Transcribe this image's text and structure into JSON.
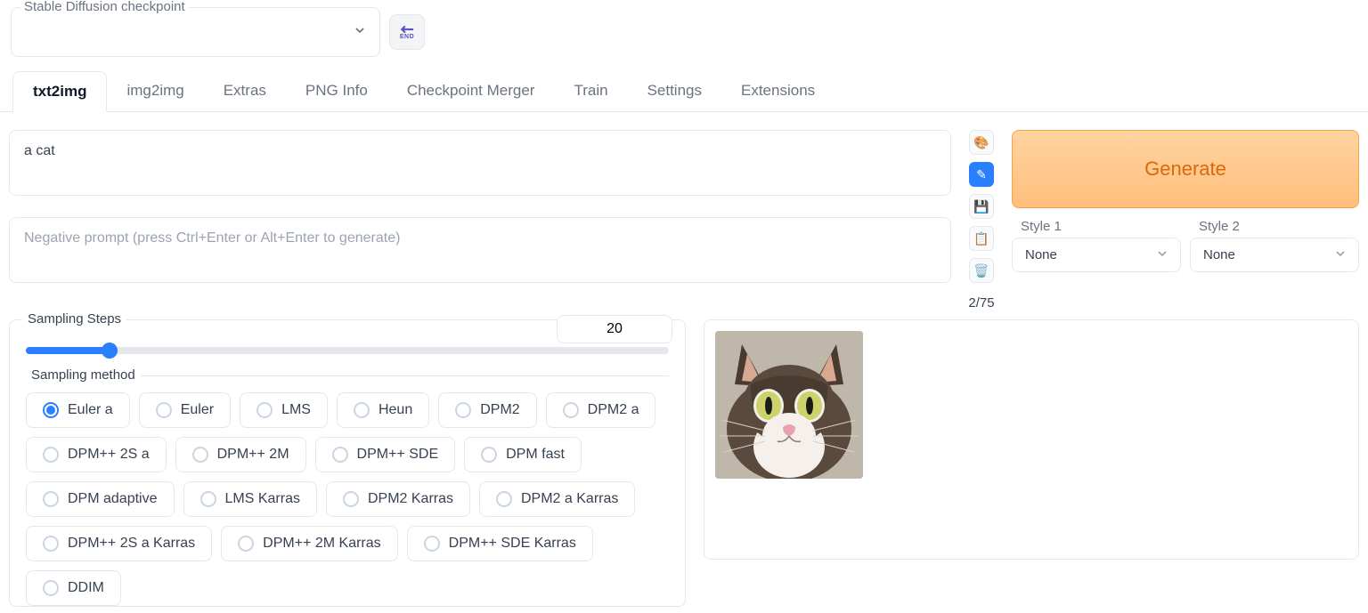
{
  "checkpoint": {
    "label": "Stable Diffusion checkpoint",
    "value": ""
  },
  "tabs": [
    "txt2img",
    "img2img",
    "Extras",
    "PNG Info",
    "Checkpoint Merger",
    "Train",
    "Settings",
    "Extensions"
  ],
  "active_tab": 0,
  "prompt": {
    "value": "a cat",
    "negative_placeholder": "Negative prompt (press Ctrl+Enter or Alt+Enter to generate)"
  },
  "token_count": "2/75",
  "generate_label": "Generate",
  "styles": {
    "style1": {
      "label": "Style 1",
      "value": "None"
    },
    "style2": {
      "label": "Style 2",
      "value": "None"
    }
  },
  "sampling_steps": {
    "label": "Sampling Steps",
    "value": "20"
  },
  "sampling_method": {
    "label": "Sampling method",
    "selected": "Euler a",
    "options": [
      "Euler a",
      "Euler",
      "LMS",
      "Heun",
      "DPM2",
      "DPM2 a",
      "DPM++ 2S a",
      "DPM++ 2M",
      "DPM++ SDE",
      "DPM fast",
      "DPM adaptive",
      "LMS Karras",
      "DPM2 Karras",
      "DPM2 a Karras",
      "DPM++ 2S a Karras",
      "DPM++ 2M Karras",
      "DPM++ SDE Karras",
      "DDIM"
    ]
  },
  "tool_icons": [
    "palette-icon",
    "interrogate-icon",
    "save-icon",
    "clipboard-icon",
    "trash-icon"
  ]
}
